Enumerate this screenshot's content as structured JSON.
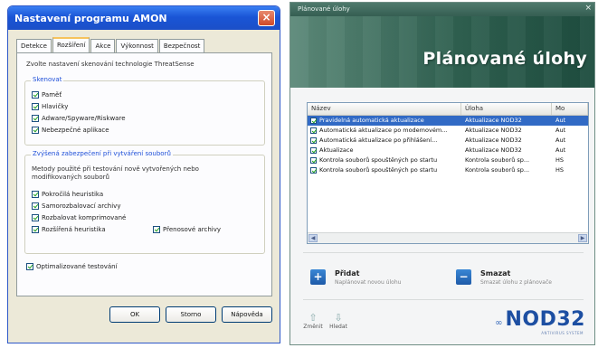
{
  "left_window": {
    "title": "Nastavení programu AMON",
    "close_label": "×",
    "tabs": [
      "Detekce",
      "Rozšíření",
      "Akce",
      "Výkonnost",
      "Bezpečnost"
    ],
    "intro_text": "Zvolte nastavení skenování technologie ThreatSense",
    "group1": {
      "title": "Skenovat",
      "items": [
        "Paměť",
        "Hlavičky",
        "Adware/Spyware/Riskware",
        "Nebezpečné aplikace"
      ]
    },
    "group2": {
      "title": "Zvýšená zabezpečení při vytváření souborů",
      "description": "Metody použité při testování nově vytvořených nebo modifikovaných souborů",
      "items": [
        "Pokročilá heuristika",
        "Samorozbalovací archivy",
        "Rozbalovat komprimované",
        "Rozšířená heuristika",
        "Přenosové archivy"
      ]
    },
    "extra_check": "Optimalizované testování",
    "buttons": {
      "ok": "OK",
      "cancel": "Storno",
      "help": "Nápověda"
    }
  },
  "right_window": {
    "title": "Plánované úlohy",
    "close_label": "×",
    "banner_title": "Plánované úlohy",
    "columns": [
      "Název",
      "Úloha",
      "Mo"
    ],
    "rows": [
      {
        "name": "Pravidelná automatická aktualizace",
        "task": "Aktualizace NOD32",
        "mode": "Aut",
        "selected": true
      },
      {
        "name": "Automatická aktualizace po modemovém...",
        "task": "Aktualizace NOD32",
        "mode": "Aut",
        "selected": false
      },
      {
        "name": "Automatická aktualizace po přihlášení...",
        "task": "Aktualizace NOD32",
        "mode": "Aut",
        "selected": false
      },
      {
        "name": "Aktualizace",
        "task": "Aktualizace NOD32",
        "mode": "Aut",
        "selected": false
      },
      {
        "name": "Kontrola souborů spouštěných po startu",
        "task": "Kontrola souborů sp...",
        "mode": "HS",
        "selected": false
      },
      {
        "name": "Kontrola souborů spouštěných po startu",
        "task": "Kontrola souborů sp...",
        "mode": "HS",
        "selected": false
      }
    ],
    "actions": {
      "add": {
        "icon": "+",
        "label": "Přidat",
        "sub": "Naplánovat novou úlohu"
      },
      "delete": {
        "icon": "−",
        "label": "Smazat",
        "sub": "Smazat úlohu z plánovače"
      }
    },
    "small_buttons": [
      {
        "glyph": "⇧",
        "label": "Změnit"
      },
      {
        "glyph": "⇩",
        "label": "Hledat"
      }
    ],
    "logo": {
      "eye": "∞",
      "text": "NOD32",
      "tagline": "ANTIVIRUS SYSTEM"
    }
  }
}
